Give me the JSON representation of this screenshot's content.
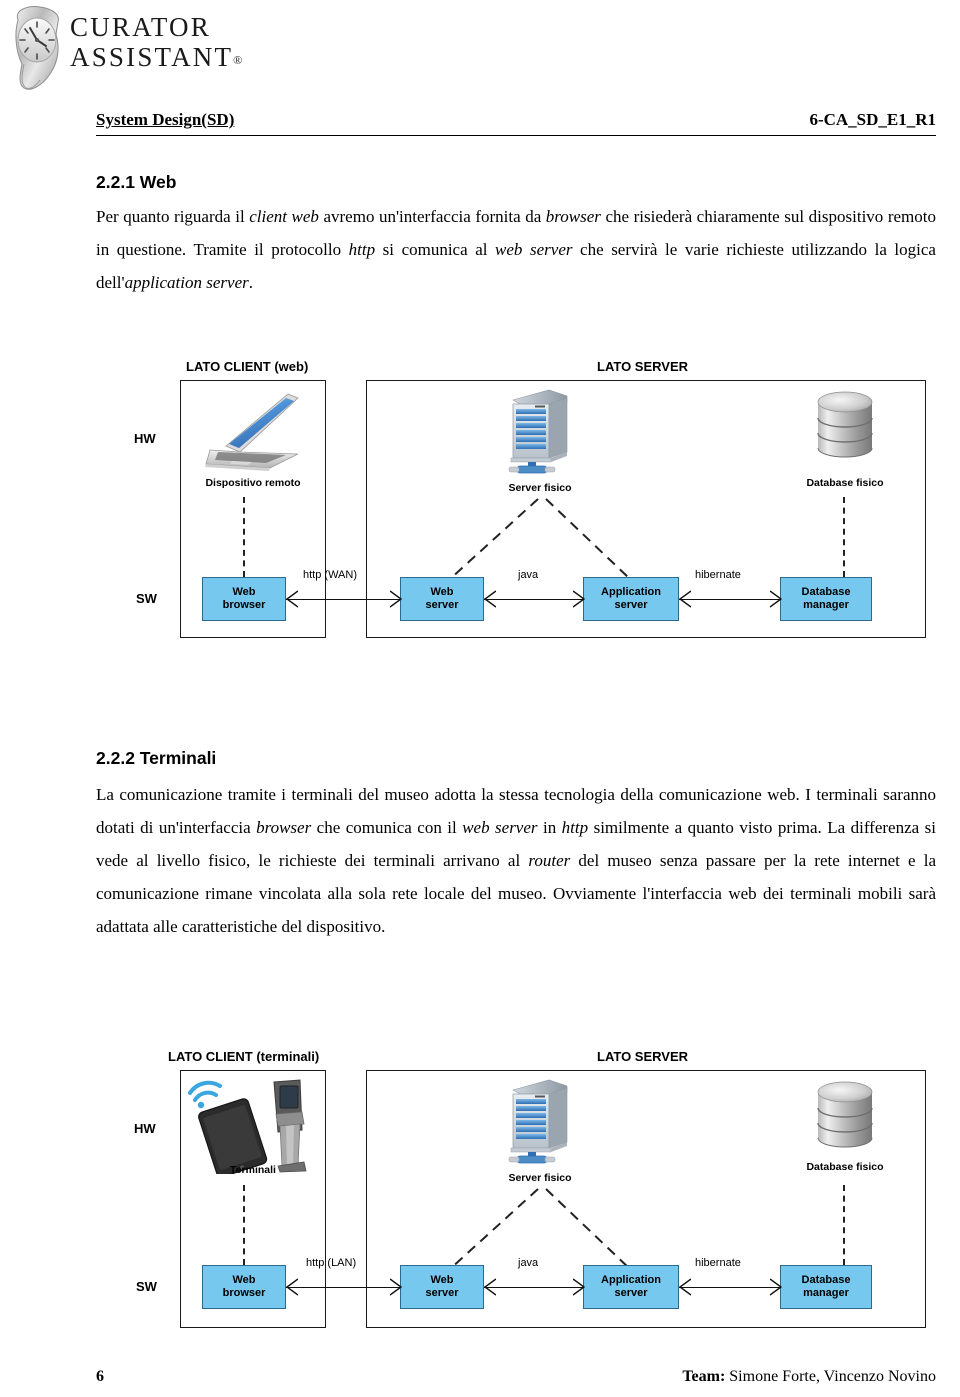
{
  "logo": {
    "line1": "CURATOR",
    "line2": "ASSISTANT",
    "registered": "®",
    "icon": "melting-clock-icon"
  },
  "header": {
    "left": "System Design(SD)",
    "right": "6-CA_SD_E1_R1"
  },
  "sections": [
    {
      "number_title": "2.2.1 Web",
      "paragraph_html": "Per quanto riguarda il <i>client web</i> avremo un'interfaccia fornita da <i>browser</i> che risiederà chiaramente sul dispositivo remoto in questione. Tramite il protocollo <i>http</i> si comunica al <i>web server</i> che servirà le varie richieste utilizzando la logica dell'<i>application server</i>."
    },
    {
      "number_title": "2.2.2  Terminali",
      "paragraph_html": "La comunicazione tramite i terminali del museo adotta la stessa tecnologia della comunicazione web. I terminali saranno dotati di un'interfaccia <i>browser</i> che comunica con il <i>web server</i> in <i>http</i> similmente a quanto visto prima. La differenza si  vede al livello fisico, le richieste dei terminali arrivano al <i>router</i> del museo senza passare per la rete internet e la comunicazione rimane vincolata alla sola rete locale del museo. Ovviamente l'interfaccia web dei terminali mobili sarà adattata alle caratteristiche del dispositivo."
    }
  ],
  "diagram_web": {
    "client_title": "LATO CLIENT (web)",
    "server_title": "LATO SERVER",
    "row_hw": "HW",
    "row_sw": "SW",
    "hw_nodes": [
      {
        "caption": "Dispositivo remoto",
        "icon": "laptop-icon"
      },
      {
        "caption": "Server fisico",
        "icon": "server-rack-icon"
      },
      {
        "caption": "Database fisico",
        "icon": "database-cylinder-icon"
      }
    ],
    "sw_nodes": [
      {
        "label_line1": "Web",
        "label_line2": "browser"
      },
      {
        "label_line1": "Web",
        "label_line2": "server"
      },
      {
        "label_line1": "Application",
        "label_line2": "server"
      },
      {
        "label_line1": "Database",
        "label_line2": "manager"
      }
    ],
    "connections": [
      {
        "label": "http (WAN)"
      },
      {
        "label": "java"
      },
      {
        "label": "hibernate"
      }
    ]
  },
  "diagram_terminali": {
    "client_title": "LATO CLIENT (terminali)",
    "server_title": "LATO SERVER",
    "row_hw": "HW",
    "row_sw": "SW",
    "hw_nodes": [
      {
        "caption": "Terminali",
        "icon": "tablet-kiosk-wifi-icon"
      },
      {
        "caption": "Server fisico",
        "icon": "server-rack-icon"
      },
      {
        "caption": "Database fisico",
        "icon": "database-cylinder-icon"
      }
    ],
    "sw_nodes": [
      {
        "label_line1": "Web",
        "label_line2": "browser"
      },
      {
        "label_line1": "Web",
        "label_line2": "server"
      },
      {
        "label_line1": "Application",
        "label_line2": "server"
      },
      {
        "label_line1": "Database",
        "label_line2": "manager"
      }
    ],
    "connections": [
      {
        "label": "http (LAN)"
      },
      {
        "label": "java"
      },
      {
        "label": "hibernate"
      }
    ]
  },
  "footer": {
    "page_number": "6",
    "team_label": "Team:",
    "team_names": " Simone Forte, Vincenzo Novino"
  },
  "colors": {
    "sw_box_fill": "#76c8ee",
    "sw_box_border": "#2b6a8c",
    "frame_border": "#1a1a1a",
    "text": "#000000"
  }
}
